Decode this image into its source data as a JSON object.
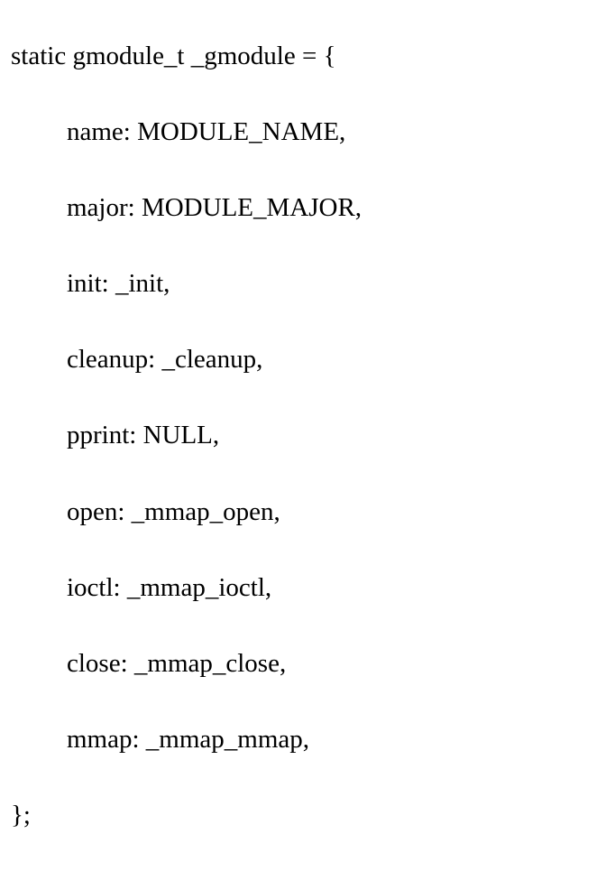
{
  "code": {
    "line1": "static gmodule_t _gmodule = {",
    "fields": [
      "name: MODULE_NAME,",
      "major: MODULE_MAJOR,",
      "init: _init,",
      "cleanup: _cleanup,",
      "pprint: NULL,",
      "open: _mmap_open,",
      "ioctl: _mmap_ioctl,",
      "close: _mmap_close,",
      "mmap: _mmap_mmap,"
    ],
    "lineEnd": "};"
  }
}
